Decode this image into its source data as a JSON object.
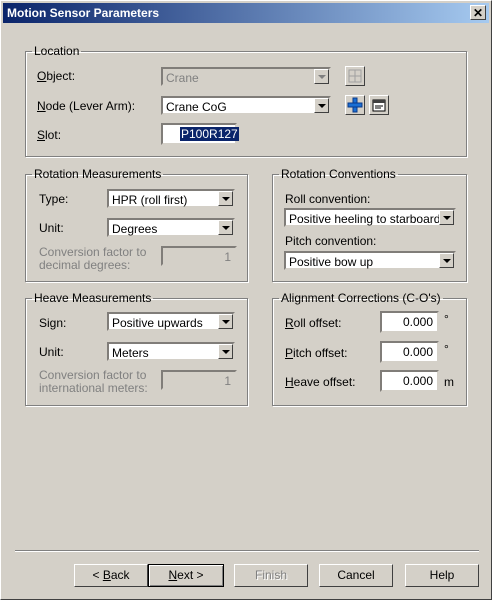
{
  "window": {
    "title": "Motion Sensor Parameters",
    "close_glyph": "✕"
  },
  "location": {
    "legend": "Location",
    "object": {
      "label_u": "O",
      "label_rest": "bject:",
      "value": "Crane"
    },
    "node": {
      "label_u": "N",
      "label_rest": "ode (Lever Arm):",
      "value": "Crane CoG"
    },
    "slot": {
      "label_u": "S",
      "label_rest": "lot:",
      "value": "P100R127"
    }
  },
  "rotation_measurements": {
    "legend": "Rotation Measurements",
    "type_label": "Type:",
    "type_value": "HPR (roll first)",
    "unit_label": "Unit:",
    "unit_value": "Degrees",
    "conv_label_1": "Conversion factor to",
    "conv_label_2": "decimal degrees:",
    "conv_value": "1"
  },
  "rotation_conventions": {
    "legend": "Rotation Conventions",
    "roll_label": "Roll convention:",
    "roll_value": "Positive heeling to starboard",
    "pitch_label": "Pitch convention:",
    "pitch_value": "Positive bow up"
  },
  "heave_measurements": {
    "legend": "Heave Measurements",
    "sign_label": "Sign:",
    "sign_value": "Positive upwards",
    "unit_label": "Unit:",
    "unit_value": "Meters",
    "conv_label_1": "Conversion factor to",
    "conv_label_2": "international meters:",
    "conv_value": "1"
  },
  "alignment": {
    "legend": "Alignment Corrections (C-O's)",
    "roll_u": "R",
    "roll_rest": "oll offset:",
    "roll_value": "0.000",
    "roll_unit": "°",
    "pitch_u": "P",
    "pitch_rest": "itch offset:",
    "pitch_value": "0.000",
    "pitch_unit": "°",
    "heave_u": "H",
    "heave_rest": "eave offset:",
    "heave_value": "0.000",
    "heave_unit": "m"
  },
  "buttons": {
    "back_pre": "< ",
    "back_u": "B",
    "back_rest": "ack",
    "next_u": "N",
    "next_rest": "ext >",
    "finish": "Finish",
    "cancel": "Cancel",
    "help": "Help"
  },
  "icons": {
    "object_action": "structure-icon",
    "node_add": "add-node-icon",
    "node_props": "properties-icon"
  },
  "colors": {
    "title_start": "#0a246a",
    "title_end": "#a6caf0",
    "selection": "#0a246a",
    "add_icon": "#1a6fd4"
  }
}
